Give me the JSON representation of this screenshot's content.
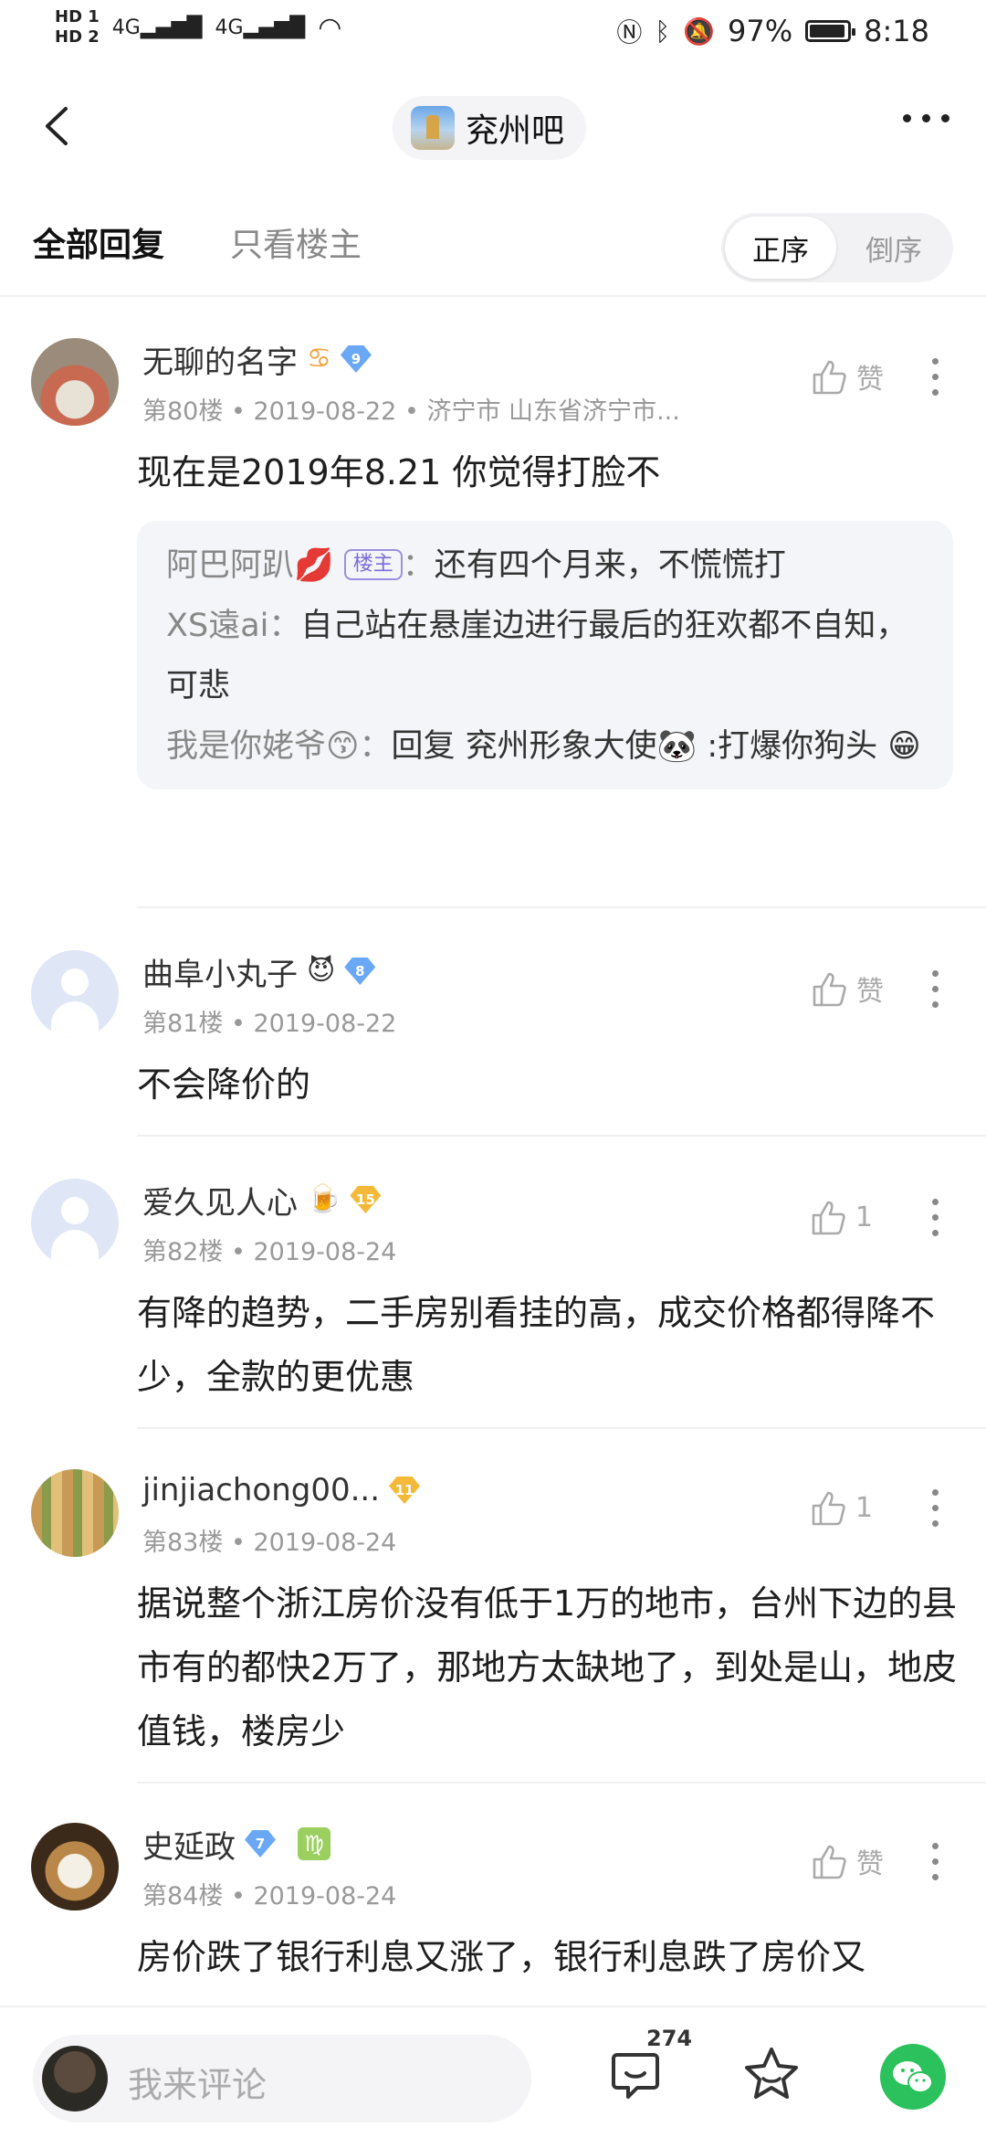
{
  "status_bar": {
    "hd1": "HD 1",
    "hd2": "HD 2",
    "net1": "4G",
    "net2": "4G",
    "battery": "97%",
    "time": "8:18"
  },
  "nav": {
    "forum_name": "兖州吧"
  },
  "tabs": {
    "all": "全部回复",
    "owner_only": "只看楼主",
    "sort_asc": "正序",
    "sort_desc": "倒序"
  },
  "posts": [
    {
      "username": "无聊的名字",
      "emoji": "♋",
      "level": "9",
      "meta": "第80楼 • 2019-08-22 •   济宁市 山东省济宁市...",
      "like": "赞",
      "content": "现在是2019年8.21 你觉得打脸不",
      "quotes": [
        {
          "name": "阿巴阿趴💋",
          "tag": "楼主",
          "sep": "：",
          "text": "还有四个月来，不慌慌打"
        },
        {
          "name": "XS遠ai",
          "sep": "：",
          "text": "自己站在悬崖边进行最后的狂欢都不自知，可悲"
        },
        {
          "name": "我是你姥爷😙",
          "sep": "：",
          "text": "回复 兖州形象大使🐼 :打爆你狗头 😁"
        }
      ]
    },
    {
      "username": "曲阜小丸子",
      "emoji": "😈",
      "level": "8",
      "meta": "第81楼 • 2019-08-22",
      "like": "赞",
      "content": "不会降价的"
    },
    {
      "username": "爱久见人心",
      "emoji": "🍺",
      "level": "15",
      "meta": "第82楼 • 2019-08-24",
      "like": "1",
      "content": "有降的趋势，二手房别看挂的高，成交价格都得降不少，全款的更优惠"
    },
    {
      "username": "jinjiachong00...",
      "level": "11",
      "meta": "第83楼 • 2019-08-24",
      "like": "1",
      "content": "据说整个浙江房价没有低于1万的地市，台州下边的县市有的都快2万了，那地方太缺地了，到处是山，地皮值钱，楼房少"
    },
    {
      "username": "史延政",
      "level": "7",
      "zodiac": "♍",
      "meta": "第84楼 • 2019-08-24",
      "like": "赞",
      "content": "房价跌了银行利息又涨了，银行利息跌了房价又"
    }
  ],
  "bottom": {
    "placeholder": "我来评论",
    "reply_count": "274"
  },
  "colors": {
    "accent_purple": "#7b6cd9",
    "level_blue": "#6aa8f5",
    "level_gold": "#f5b93a",
    "wechat_green": "#2bc15d"
  }
}
